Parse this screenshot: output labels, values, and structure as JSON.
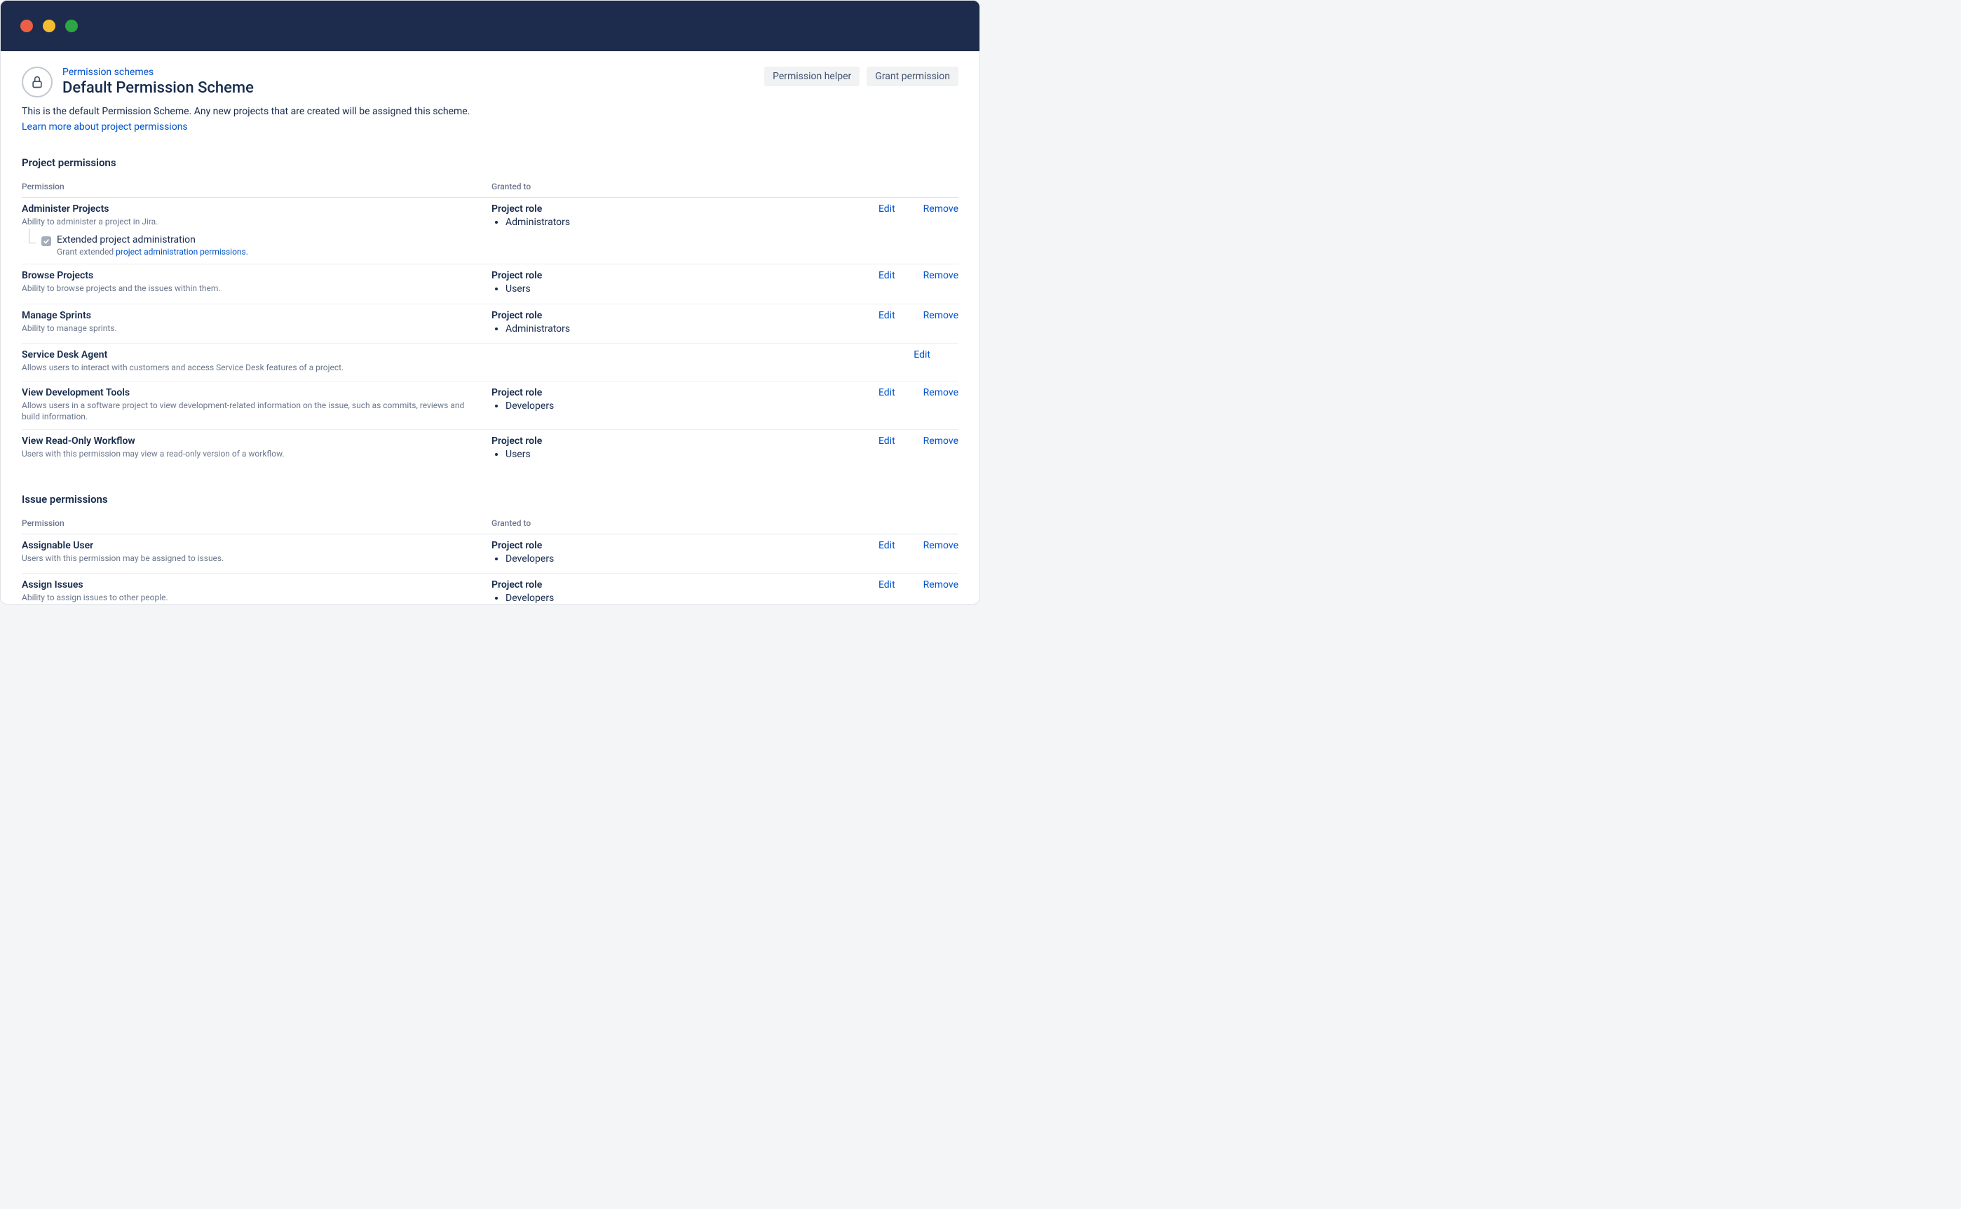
{
  "breadcrumb": {
    "label": "Permission schemes"
  },
  "title": "Default Permission Scheme",
  "description": "This is the default Permission Scheme. Any new projects that are created will be assigned this scheme.",
  "learn_more": "Learn more about project permissions",
  "header_buttons": {
    "permission_helper": "Permission helper",
    "grant_permission": "Grant permission"
  },
  "columns": {
    "permission": "Permission",
    "granted_to": "Granted to"
  },
  "actions": {
    "edit": "Edit",
    "remove": "Remove"
  },
  "granted_label": "Project role",
  "sections": [
    {
      "title": "Project permissions",
      "rows": [
        {
          "name": "Administer Projects",
          "desc": "Ability to administer a project in Jira.",
          "granted": [
            "Administrators"
          ],
          "edit": true,
          "remove": true,
          "sub": {
            "label": "Extended project administration",
            "desc_prefix": "Grant extended ",
            "desc_link": "project administration permissions."
          }
        },
        {
          "name": "Browse Projects",
          "desc": "Ability to browse projects and the issues within them.",
          "granted": [
            "Users"
          ],
          "edit": true,
          "remove": true
        },
        {
          "name": "Manage Sprints",
          "desc": "Ability to manage sprints.",
          "granted": [
            "Administrators"
          ],
          "edit": true,
          "remove": true
        },
        {
          "name": "Service Desk Agent",
          "desc": "Allows users to interact with customers and access Service Desk features of a project.",
          "granted": [],
          "edit": true,
          "remove": false
        },
        {
          "name": "View Development Tools",
          "desc": "Allows users in a software project to view development-related information on the issue, such as commits, reviews and build information.",
          "granted": [
            "Developers"
          ],
          "edit": true,
          "remove": true
        },
        {
          "name": "View Read-Only Workflow",
          "desc": "Users with this permission may view a read-only version of a workflow.",
          "granted": [
            "Users"
          ],
          "edit": true,
          "remove": true
        }
      ]
    },
    {
      "title": "Issue permissions",
      "rows": [
        {
          "name": "Assignable User",
          "desc": "Users with this permission may be assigned to issues.",
          "granted": [
            "Developers"
          ],
          "edit": true,
          "remove": true
        },
        {
          "name": "Assign Issues",
          "desc": "Ability to assign issues to other people.",
          "granted": [
            "Developers"
          ],
          "edit": true,
          "remove": true
        }
      ]
    }
  ]
}
